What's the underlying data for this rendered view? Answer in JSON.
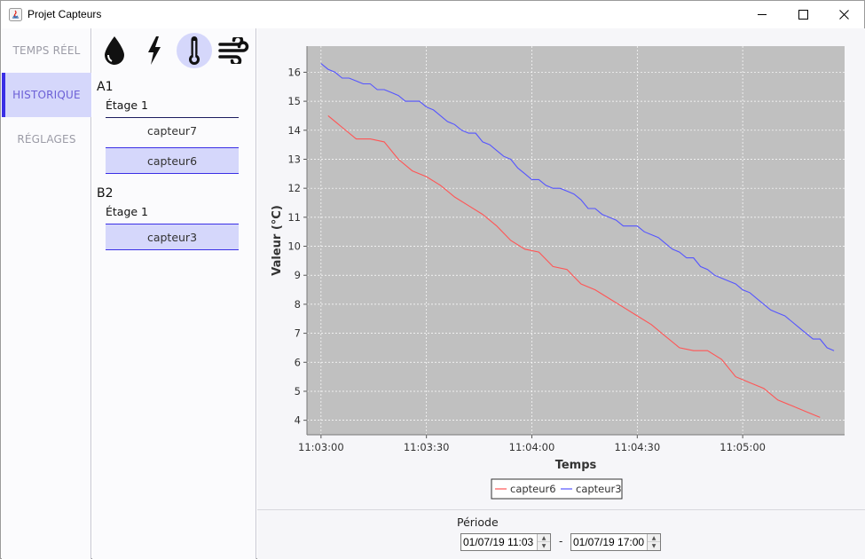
{
  "window": {
    "title": "Projet Capteurs"
  },
  "nav": {
    "items": [
      {
        "label": "TEMPS RÉEL",
        "active": false
      },
      {
        "label": "HISTORIQUE",
        "active": true
      },
      {
        "label": "RÉGLAGES",
        "active": false
      }
    ]
  },
  "sensor_types": [
    "humidity-drop-icon",
    "power-lightning-icon",
    "temperature-thermometer-icon",
    "wind-airflow-icon"
  ],
  "active_sensor_type": "temperature-thermometer-icon",
  "groups": [
    {
      "name": "A1",
      "floors": [
        {
          "name": "Étage 1",
          "sensors": [
            {
              "name": "capteur7",
              "selected": false
            },
            {
              "name": "capteur6",
              "selected": true
            }
          ]
        }
      ]
    },
    {
      "name": "B2",
      "floors": [
        {
          "name": "Étage 1",
          "sensors": [
            {
              "name": "capteur3",
              "selected": true
            }
          ]
        }
      ]
    }
  ],
  "period": {
    "label": "Période",
    "start": "01/07/19 11:03",
    "separator": "-",
    "end": "01/07/19 17:00"
  },
  "colors": {
    "accent": "#3a2fe6",
    "selected_bg": "#d5d7fb",
    "plot_bg": "#c0c0c0",
    "series_red": "#ff5555",
    "series_blue": "#5555ff"
  },
  "chart_data": {
    "type": "line",
    "xlabel": "Temps",
    "ylabel": "Valeur (°C)",
    "x_ticks": [
      "11:03:00",
      "11:03:30",
      "11:04:00",
      "11:04:30",
      "11:05:00"
    ],
    "y_ticks": [
      4,
      5,
      6,
      7,
      8,
      9,
      10,
      11,
      12,
      13,
      14,
      15,
      16
    ],
    "xlim": [
      "11:02:56",
      "11:05:29"
    ],
    "ylim": [
      3.5,
      16.9
    ],
    "grid": true,
    "legend": "bottom-center",
    "series": [
      {
        "name": "capteur6",
        "color": "#ff5555",
        "x": [
          "11:03:02",
          "11:03:06",
          "11:03:10",
          "11:03:14",
          "11:03:18",
          "11:03:22",
          "11:03:26",
          "11:03:30",
          "11:03:34",
          "11:03:38",
          "11:03:42",
          "11:03:46",
          "11:03:50",
          "11:03:54",
          "11:03:58",
          "11:04:02",
          "11:04:06",
          "11:04:10",
          "11:04:14",
          "11:04:18",
          "11:04:22",
          "11:04:26",
          "11:04:30",
          "11:04:34",
          "11:04:38",
          "11:04:42",
          "11:04:46",
          "11:04:50",
          "11:04:54",
          "11:04:58",
          "11:05:02",
          "11:05:06",
          "11:05:10",
          "11:05:14",
          "11:05:18",
          "11:05:22"
        ],
        "y": [
          14.5,
          14.1,
          13.7,
          13.7,
          13.6,
          13.0,
          12.6,
          12.4,
          12.1,
          11.7,
          11.4,
          11.1,
          10.7,
          10.2,
          9.9,
          9.8,
          9.3,
          9.2,
          8.7,
          8.5,
          8.2,
          7.9,
          7.6,
          7.3,
          6.9,
          6.5,
          6.4,
          6.4,
          6.1,
          5.5,
          5.3,
          5.1,
          4.7,
          4.5,
          4.3,
          4.1
        ]
      },
      {
        "name": "capteur3",
        "color": "#5555ff",
        "x": [
          "11:03:00",
          "11:03:02",
          "11:03:04",
          "11:03:06",
          "11:03:08",
          "11:03:10",
          "11:03:12",
          "11:03:14",
          "11:03:16",
          "11:03:18",
          "11:03:20",
          "11:03:22",
          "11:03:24",
          "11:03:26",
          "11:03:28",
          "11:03:30",
          "11:03:32",
          "11:03:34",
          "11:03:36",
          "11:03:38",
          "11:03:40",
          "11:03:42",
          "11:03:44",
          "11:03:46",
          "11:03:48",
          "11:03:50",
          "11:03:52",
          "11:03:54",
          "11:03:56",
          "11:03:58",
          "11:04:00",
          "11:04:02",
          "11:04:04",
          "11:04:06",
          "11:04:08",
          "11:04:10",
          "11:04:12",
          "11:04:14",
          "11:04:16",
          "11:04:18",
          "11:04:20",
          "11:04:22",
          "11:04:24",
          "11:04:26",
          "11:04:28",
          "11:04:30",
          "11:04:32",
          "11:04:34",
          "11:04:36",
          "11:04:38",
          "11:04:40",
          "11:04:42",
          "11:04:44",
          "11:04:46",
          "11:04:48",
          "11:04:50",
          "11:04:52",
          "11:04:54",
          "11:04:56",
          "11:04:58",
          "11:05:00",
          "11:05:02",
          "11:05:04",
          "11:05:06",
          "11:05:08",
          "11:05:10",
          "11:05:12",
          "11:05:14",
          "11:05:16",
          "11:05:18",
          "11:05:20",
          "11:05:22",
          "11:05:24",
          "11:05:26"
        ],
        "y": [
          16.3,
          16.1,
          16.0,
          15.8,
          15.8,
          15.7,
          15.6,
          15.6,
          15.4,
          15.4,
          15.3,
          15.2,
          15.0,
          15.0,
          15.0,
          14.8,
          14.7,
          14.5,
          14.3,
          14.2,
          14.0,
          13.9,
          13.9,
          13.6,
          13.5,
          13.3,
          13.1,
          13.0,
          12.7,
          12.5,
          12.3,
          12.3,
          12.1,
          12.0,
          12.0,
          11.9,
          11.8,
          11.6,
          11.3,
          11.3,
          11.1,
          11.0,
          10.9,
          10.7,
          10.7,
          10.7,
          10.5,
          10.4,
          10.3,
          10.1,
          9.9,
          9.8,
          9.6,
          9.6,
          9.3,
          9.2,
          9.0,
          8.9,
          8.8,
          8.7,
          8.5,
          8.4,
          8.2,
          8.0,
          7.8,
          7.7,
          7.6,
          7.4,
          7.2,
          7.0,
          6.8,
          6.8,
          6.5,
          6.4
        ]
      }
    ]
  }
}
